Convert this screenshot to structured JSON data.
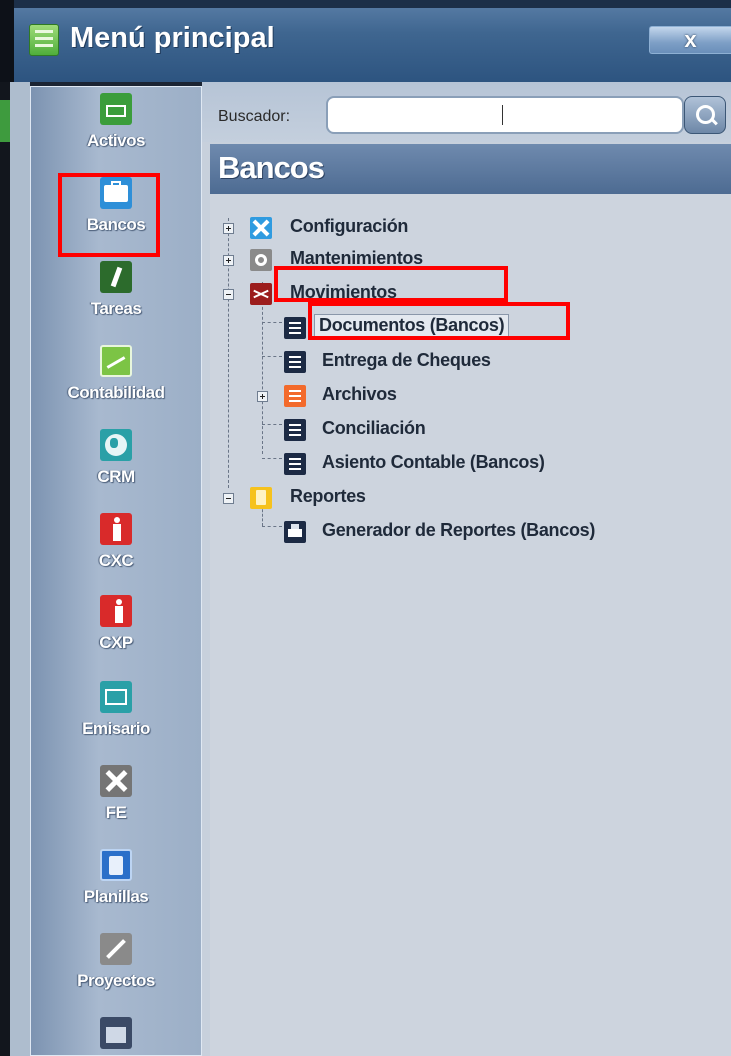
{
  "window": {
    "title": "Menú principal",
    "close_label": "x"
  },
  "sidebar": {
    "items": [
      {
        "label": "Activos",
        "icon": "cash-register-icon"
      },
      {
        "label": "Bancos",
        "icon": "briefcase-icon",
        "highlighted": true
      },
      {
        "label": "Tareas",
        "icon": "tasks-icon"
      },
      {
        "label": "Contabilidad",
        "icon": "chart-icon"
      },
      {
        "label": "CRM",
        "icon": "globe-icon"
      },
      {
        "label": "CXC",
        "icon": "person-receivable-icon"
      },
      {
        "label": "CXP",
        "icon": "person-payable-icon"
      },
      {
        "label": "Emisario",
        "icon": "envelope-icon"
      },
      {
        "label": "FE",
        "icon": "tools-icon"
      },
      {
        "label": "Planillas",
        "icon": "document-icon"
      },
      {
        "label": "Proyectos",
        "icon": "tools-icon"
      },
      {
        "label": "",
        "icon": "factory-icon"
      }
    ]
  },
  "search": {
    "label": "Buscador:",
    "value": "",
    "placeholder": ""
  },
  "section": {
    "title": "Bancos"
  },
  "tree": {
    "configuracion": "Configuración",
    "mantenimientos": "Mantenimientos",
    "movimientos": "Movimientos",
    "documentos": "Documentos (Bancos)",
    "entrega_cheques": "Entrega de Cheques",
    "archivos": "Archivos",
    "conciliacion": "Conciliación",
    "asiento": "Asiento Contable (Bancos)",
    "reportes": "Reportes",
    "generador": "Generador de Reportes (Bancos)"
  },
  "colors": {
    "highlight": "#ff0000",
    "titlebar": "#3f6690",
    "section_header": "#5b789f"
  }
}
